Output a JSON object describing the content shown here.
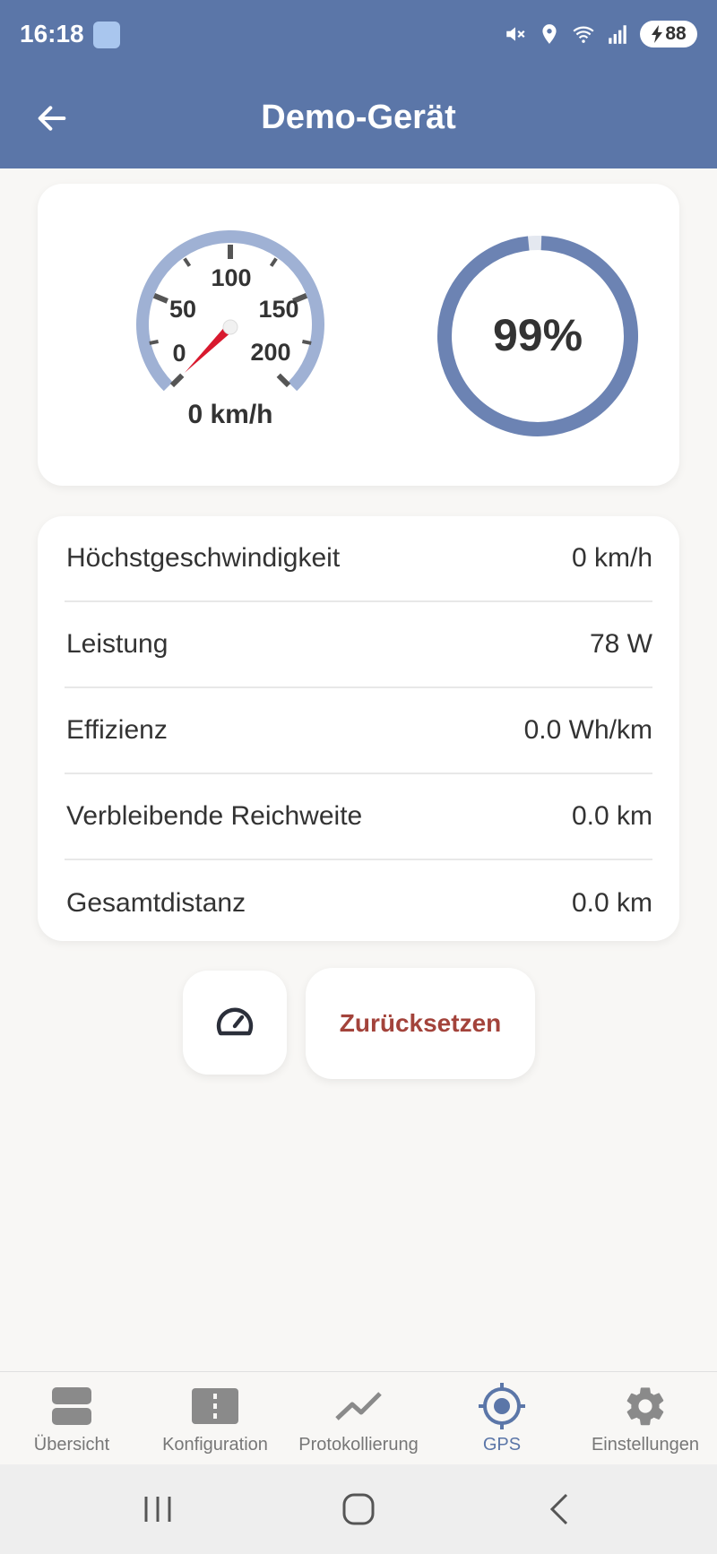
{
  "status_bar": {
    "time": "16:18",
    "battery": "88",
    "icons": [
      "app-notification-icon",
      "mute-icon",
      "location-icon",
      "wifi-icon",
      "signal-icon",
      "battery-charging-icon"
    ]
  },
  "app_bar": {
    "title": "Demo-Gerät",
    "back_icon": "arrow-left-icon"
  },
  "speed_gauge": {
    "value_text": "0 km/h",
    "ticks": [
      "0",
      "50",
      "100",
      "150",
      "200"
    ],
    "current_speed": 0,
    "max": 200,
    "arc_color": "#9fb1d4",
    "needle_color": "#d8192e"
  },
  "battery_gauge": {
    "value_text": "99%",
    "percent": 99,
    "ring_color": "#6c83b3"
  },
  "stats": [
    {
      "label": "Höchstgeschwindigkeit",
      "value": "0 km/h"
    },
    {
      "label": "Leistung",
      "value": "78 W"
    },
    {
      "label": "Effizienz",
      "value": "0.0 Wh/km"
    },
    {
      "label": "Verbleibende Reichweite",
      "value": "0.0 km"
    },
    {
      "label": "Gesamtdistanz",
      "value": "0.0 km"
    }
  ],
  "actions": {
    "gauge_icon": "speedometer-icon",
    "reset_label": "Zurücksetzen",
    "reset_color": "#a3433b"
  },
  "bottom_nav": [
    {
      "label": "Übersicht",
      "icon": "overview-icon",
      "active": false
    },
    {
      "label": "Konfiguration",
      "icon": "configuration-icon",
      "active": false
    },
    {
      "label": "Protokollierung",
      "icon": "chart-line-icon",
      "active": false
    },
    {
      "label": "GPS",
      "icon": "gps-icon",
      "active": true
    },
    {
      "label": "Einstellungen",
      "icon": "gear-icon",
      "active": false
    }
  ],
  "accent_color": "#5b76a8"
}
